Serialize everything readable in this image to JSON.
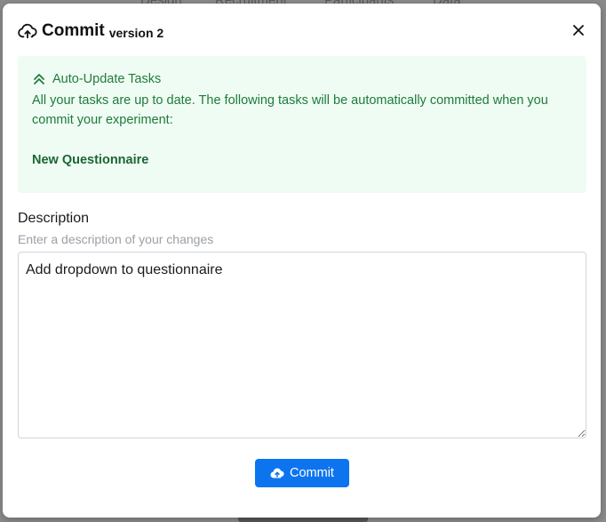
{
  "background": {
    "nav": [
      "Design",
      "Recruitment",
      "Participants",
      "Data"
    ]
  },
  "modal": {
    "title": "Commit",
    "version": "version 2",
    "close_icon": "close-icon",
    "header_icon": "cloud-upload-icon"
  },
  "alert": {
    "icon": "chevrons-up-icon",
    "title": "Auto-Update Tasks",
    "body": "All your tasks are up to date. The following tasks will be automatically committed when you commit your experiment:",
    "task": "New Questionnaire",
    "color": "#1f7a3c",
    "background": "#effcf3"
  },
  "description": {
    "label": "Description",
    "hint": "Enter a description of your changes",
    "value": "Add dropdown to questionnaire"
  },
  "commit_button": {
    "label": "Commit",
    "icon": "cloud-upload-icon",
    "color": "#0d74f0"
  }
}
